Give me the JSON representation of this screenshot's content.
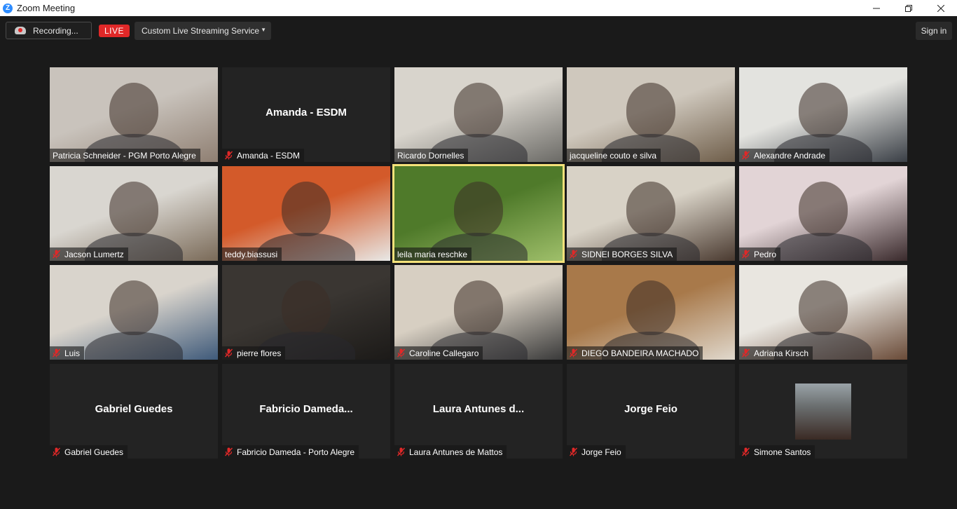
{
  "window": {
    "title": "Zoom Meeting",
    "app_icon": "Z",
    "controls": [
      "minimize",
      "restore",
      "close"
    ]
  },
  "toolbar": {
    "recording_label": "Recording...",
    "live_label": "LIVE",
    "stream_label": "Custom Live Streaming Service",
    "signin_label": "Sign in"
  },
  "participants": [
    {
      "name": "Patricia Schneider - PGM Porto Alegre",
      "muted": false,
      "video": true,
      "bg": [
        "#c9c3bc",
        "#8f7f72"
      ]
    },
    {
      "name": "Amanda - ESDM",
      "display": "Amanda - ESDM",
      "muted": true,
      "video": false
    },
    {
      "name": "Ricardo Dornelles",
      "muted": false,
      "video": true,
      "bg": [
        "#d8d4cc",
        "#6b6a66"
      ]
    },
    {
      "name": "jacqueline couto e silva",
      "muted": false,
      "video": true,
      "bg": [
        "#cfc8bd",
        "#6f5e4a"
      ]
    },
    {
      "name": "Alexandre Andrade",
      "muted": true,
      "video": true,
      "bg": [
        "#e3e3df",
        "#3a3f46"
      ]
    },
    {
      "name": "Jacson Lumertz",
      "muted": true,
      "video": true,
      "bg": [
        "#d9d6d0",
        "#7a6a58"
      ]
    },
    {
      "name": "teddy.biassusi",
      "muted": false,
      "video": true,
      "bg": [
        "#d35a2a",
        "#e8e8e6"
      ]
    },
    {
      "name": "leila maria reschke",
      "muted": false,
      "video": true,
      "active": true,
      "bg": [
        "#4f7a2a",
        "#9fbf6a"
      ]
    },
    {
      "name": "SIDNEI BORGES SILVA",
      "muted": true,
      "video": true,
      "bg": [
        "#d8d2c6",
        "#4a3a30"
      ]
    },
    {
      "name": "Pedro",
      "muted": true,
      "video": true,
      "bg": [
        "#e2d4d6",
        "#3a2a2c"
      ]
    },
    {
      "name": "Luis",
      "muted": true,
      "video": true,
      "bg": [
        "#d9d4cc",
        "#3f5a7a"
      ]
    },
    {
      "name": "pierre flores",
      "muted": true,
      "video": true,
      "bg": [
        "#3a3632",
        "#1c1a18"
      ]
    },
    {
      "name": "Caroline Callegaro",
      "muted": true,
      "video": true,
      "bg": [
        "#d7cfc2",
        "#3a3a3a"
      ]
    },
    {
      "name": "DIEGO BANDEIRA MACHADO",
      "muted": true,
      "video": true,
      "bg": [
        "#a8794a",
        "#e0d8cc"
      ]
    },
    {
      "name": "Adriana Kirsch",
      "muted": true,
      "video": true,
      "bg": [
        "#e9e6e0",
        "#6a4b38"
      ]
    },
    {
      "name": "Gabriel Guedes",
      "display": "Gabriel Guedes",
      "muted": true,
      "video": false
    },
    {
      "name": "Fabricio Dameda - Porto Alegre",
      "display": "Fabricio  Dameda...",
      "muted": true,
      "video": false
    },
    {
      "name": "Laura Antunes de Mattos",
      "display": "Laura  Antunes  d...",
      "muted": true,
      "video": false
    },
    {
      "name": "Jorge Feio",
      "display": "Jorge Feio",
      "muted": true,
      "video": false
    },
    {
      "name": "Simone Santos",
      "muted": true,
      "video": false,
      "avatar": true
    }
  ],
  "colors": {
    "background": "#1a1a1a",
    "tile": "#232323",
    "active_border": "#f5e27a",
    "live": "#e02828",
    "mute": "#e02828"
  }
}
